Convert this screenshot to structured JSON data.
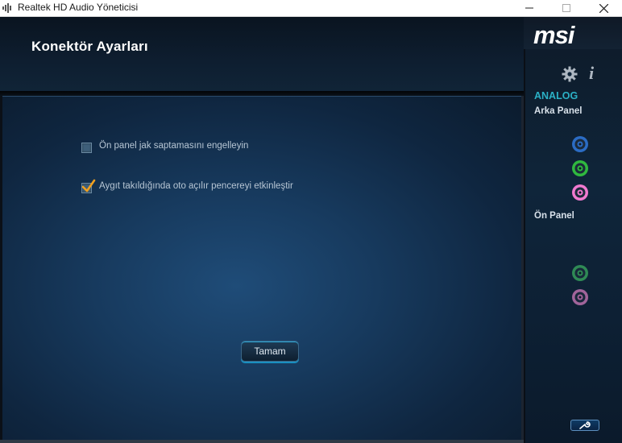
{
  "window": {
    "title": "Realtek HD Audio Yöneticisi",
    "controls": {
      "minimize": "—",
      "maximize": "☐",
      "close": "✕"
    }
  },
  "header": {
    "title": "Konektör Ayarları"
  },
  "options": [
    {
      "label": "Ön panel jak saptamasını engelleyin",
      "checked": false
    },
    {
      "label": "Aygıt takıldığında oto açılır pencereyi etkinleştir",
      "checked": true
    }
  ],
  "ok_button": {
    "label": "Tamam"
  },
  "sidebar": {
    "logo": "msi",
    "section": "ANALOG",
    "rear_panel": "Arka Panel",
    "front_panel": "Ön Panel",
    "rear_jacks": [
      {
        "name": "line-in",
        "color": "#2b6cc4",
        "enabled": true
      },
      {
        "name": "line-out",
        "color": "#2fb83f",
        "enabled": true
      },
      {
        "name": "mic-in",
        "color": "#f07ad0",
        "enabled": true
      }
    ],
    "front_jacks": [
      {
        "name": "headphone",
        "color": "#2f8a55",
        "enabled": false
      },
      {
        "name": "mic",
        "color": "#a0649a",
        "enabled": false
      }
    ]
  },
  "colors": {
    "accent": "#2bb1c6",
    "checkmark": "#f0a020"
  }
}
